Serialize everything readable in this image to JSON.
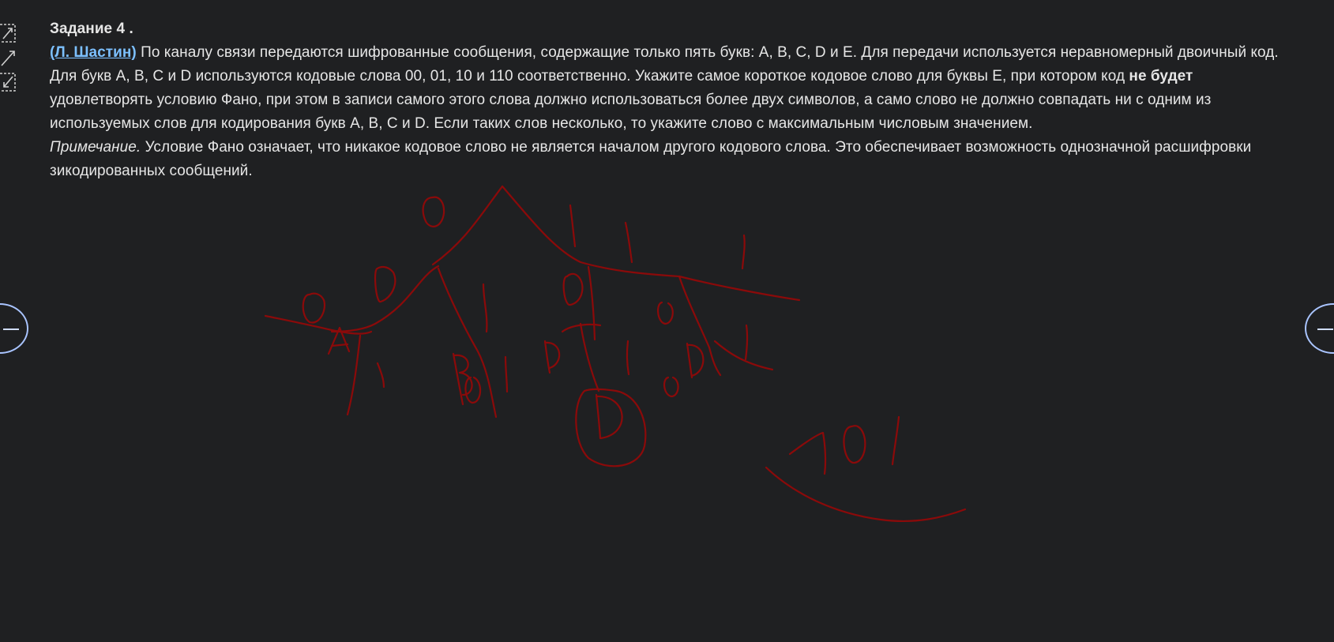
{
  "task": {
    "title": "Задание 4 .",
    "author_link": "(Л. Шастин)",
    "text_part1": " По каналу связи передаются шифрованные сообщения, содержащие только пять букв: A, B, C, D и E. Для передачи используется неравномерный двоичный код. Для букв A, B, C и D используются кодовые слова 00, 01, 10 и 110 соответственно. Укажите самое короткое кодовое слово для буквы E, при котором код ",
    "emphasis": "не будет",
    "text_part2": " удовлетворять условию Фано, при этом в записи самого этого слова должно использоваться более двух символов, а само слово не должно совпадать ни с одним из используемых слов для кодирования букв A, B, C и D. Если таких слов несколько, то укажите слово с максимальным числовым значением.",
    "note_label": "Примечание.",
    "note_text": " Условие Фано означает, что никакое кодовое слово не является началом другого кодового слова. Это обеспечивает возможность однозначной расшифровки зикодированных сообщений."
  },
  "toolbar": {
    "icons": [
      "expand-icon",
      "pencil-icon",
      "collapse-icon"
    ]
  },
  "navigation": {
    "left_icon": "minus-icon",
    "right_icon": "minus-icon"
  },
  "annotation": {
    "color": "#8b0a0a"
  }
}
